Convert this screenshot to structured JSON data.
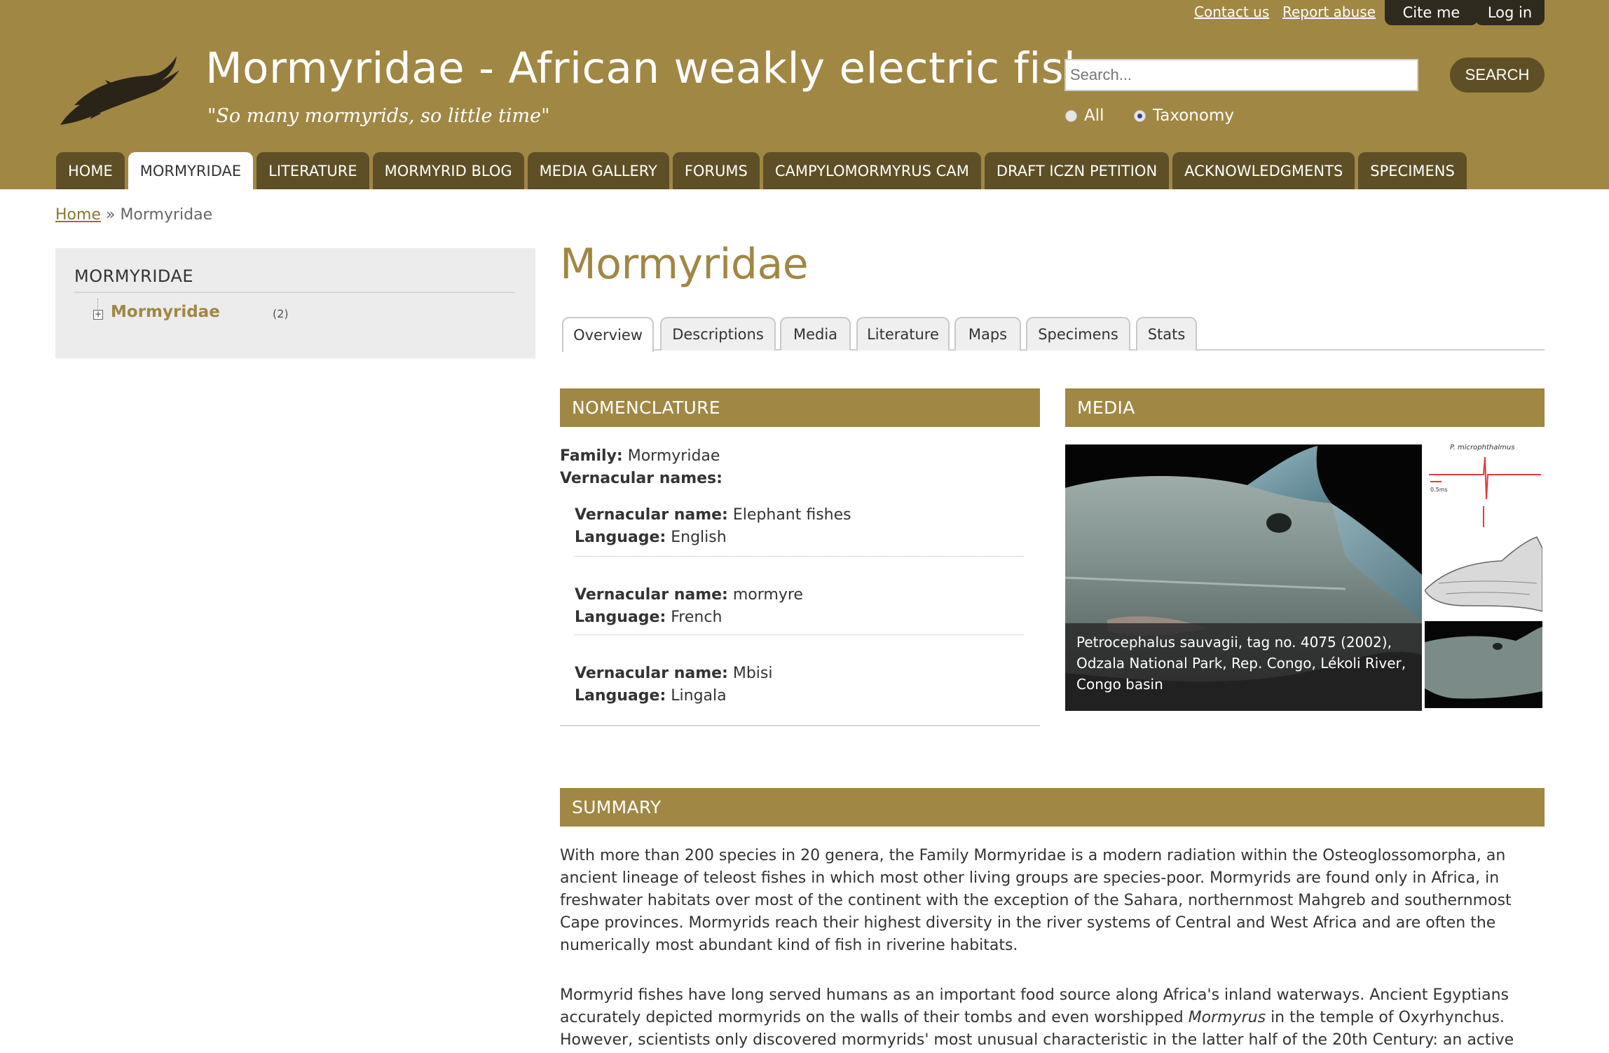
{
  "header": {
    "site_title": "Mormyridae - African weakly electric fishes",
    "slogan": "\"So many mormyrids, so little time\"",
    "colors": {
      "brand": "#a08744",
      "nav_dark": "#5e4f26",
      "top_btn": "#2f2a1e"
    },
    "top_links": {
      "contact": "Contact us",
      "report": "Report abuse"
    },
    "top_buttons": {
      "cite": "Cite me",
      "login": "Log in"
    },
    "search": {
      "placeholder": "Search...",
      "value": "",
      "button": "SEARCH"
    },
    "radio": {
      "all": "All",
      "taxonomy": "Taxonomy",
      "selected": "Taxonomy"
    }
  },
  "nav": [
    {
      "label": "HOME"
    },
    {
      "label": "MORMYRIDAE"
    },
    {
      "label": "LITERATURE"
    },
    {
      "label": "MORMYRID BLOG"
    },
    {
      "label": "MEDIA GALLERY"
    },
    {
      "label": "FORUMS"
    },
    {
      "label": "CAMPYLOMORMYRUS CAM"
    },
    {
      "label": "DRAFT ICZN PETITION"
    },
    {
      "label": "ACKNOWLEDGMENTS"
    },
    {
      "label": "SPECIMENS"
    }
  ],
  "breadcrumb": {
    "home": "Home",
    "separator": "»",
    "current": "Mormyridae"
  },
  "sidebar": {
    "title": "MORMYRIDAE",
    "tree_item": "Mormyridae",
    "tree_count": "(2)",
    "toggle_icon": "expand-icon"
  },
  "main": {
    "title": "Mormyridae",
    "tabs": [
      "Overview",
      "Descriptions",
      "Media",
      "Literature",
      "Maps",
      "Specimens",
      "Stats"
    ],
    "active_tab": "Overview"
  },
  "nomenclature": {
    "heading": "NOMENCLATURE",
    "family_label": "Family:",
    "family_value": "Mormyridae",
    "vernacular_heading": "Vernacular names:",
    "entries": [
      {
        "name_label": "Vernacular name:",
        "name": "Elephant fishes",
        "lang_label": "Language:",
        "lang": "English"
      },
      {
        "name_label": "Vernacular name:",
        "name": "mormyre",
        "lang_label": "Language:",
        "lang": "French"
      },
      {
        "name_label": "Vernacular name:",
        "name": "Mbisi",
        "lang_label": "Language:",
        "lang": "Lingala"
      }
    ]
  },
  "media": {
    "heading": "MEDIA",
    "caption": "Petrocephalus sauvagii, tag no. 4075 (2002), Odzala National Park, Rep. Congo, Lékoli River, Congo basin",
    "thumb1_label": "P. microphthalmus",
    "thumb1_scale": "0.5ms"
  },
  "summary": {
    "heading": "SUMMARY",
    "para1": "With more than 200 species in 20 genera, the Family Mormyridae is a modern radiation within the Osteoglossomorpha, an ancient lineage of teleost fishes in which most other living groups are species-poor. Mormyrids are found only in Africa, in freshwater habitats over most of the continent with the exception of the Sahara, northernmost Mahgreb and southernmost Cape provinces. Mormyrids reach their highest diversity in the river systems of Central and West Africa and are often the numerically most abundant kind of fish in riverine habitats.",
    "para2_a": "Mormyrid fishes have long served humans as an important food source along Africa's inland waterways. Ancient Egyptians accurately depicted mormyrids on the walls of their tombs and even worshipped ",
    "para2_em": "Mormyrus",
    "para2_b": " in the temple of Oxyrhynchus. However, scientists only discovered mormyrids' most unusual characteristic in the latter half of the 20th Century: an active"
  }
}
